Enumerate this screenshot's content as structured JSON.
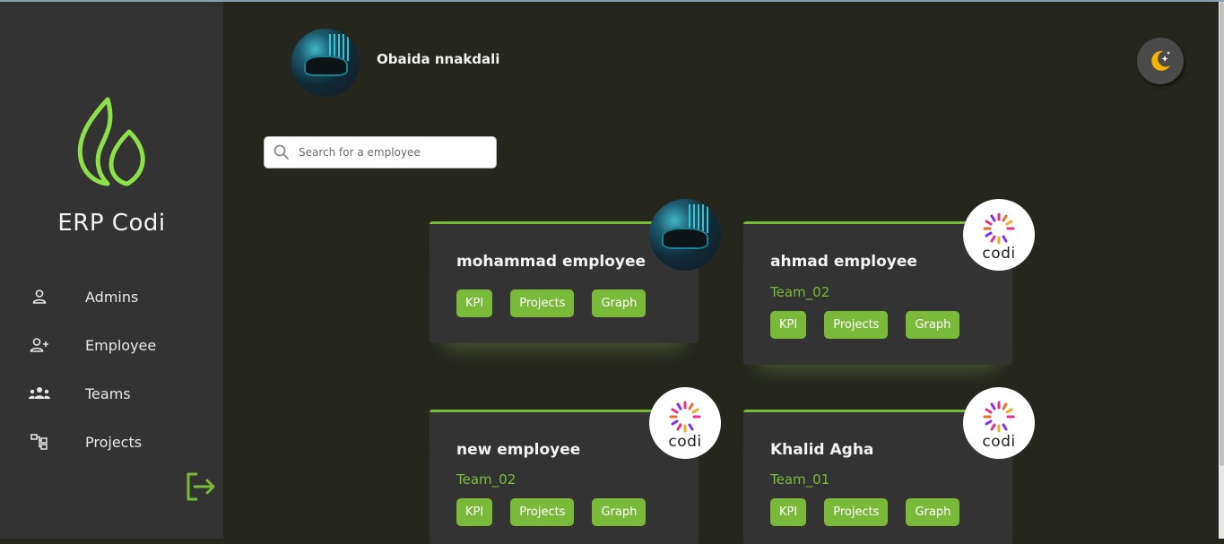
{
  "app": {
    "brand": "ERP Codi"
  },
  "sidebar": {
    "items": [
      {
        "label": "Admins",
        "icon": "user-icon"
      },
      {
        "label": "Employee",
        "icon": "user-plus-icon"
      },
      {
        "label": "Teams",
        "icon": "users-group-icon"
      },
      {
        "label": "Projects",
        "icon": "hierarchy-icon"
      }
    ],
    "logout_icon": "logout-icon"
  },
  "header": {
    "user_name": "Obaida nnakdali",
    "theme_icon": "moon-icon"
  },
  "search": {
    "placeholder": "Search for a employee",
    "value": ""
  },
  "employees": [
    {
      "name": "mohammad employee",
      "team": "",
      "avatar": "photo",
      "actions": [
        "KPI",
        "Projects",
        "Graph"
      ]
    },
    {
      "name": "ahmad employee",
      "team": "Team_02",
      "avatar": "codi",
      "actions": [
        "KPI",
        "Projects",
        "Graph"
      ]
    },
    {
      "name": "new employee",
      "team": "Team_02",
      "avatar": "codi",
      "actions": [
        "KPI",
        "Projects",
        "Graph"
      ]
    },
    {
      "name": "Khalid Agha",
      "team": "Team_01",
      "avatar": "codi",
      "actions": [
        "KPI",
        "Projects",
        "Graph"
      ]
    }
  ],
  "codi_logo_text": "codi",
  "colors": {
    "accent": "#7bb93a",
    "sidebar": "#333333",
    "background": "#25271f",
    "card": "#333333",
    "logo": "#8ee04a"
  }
}
